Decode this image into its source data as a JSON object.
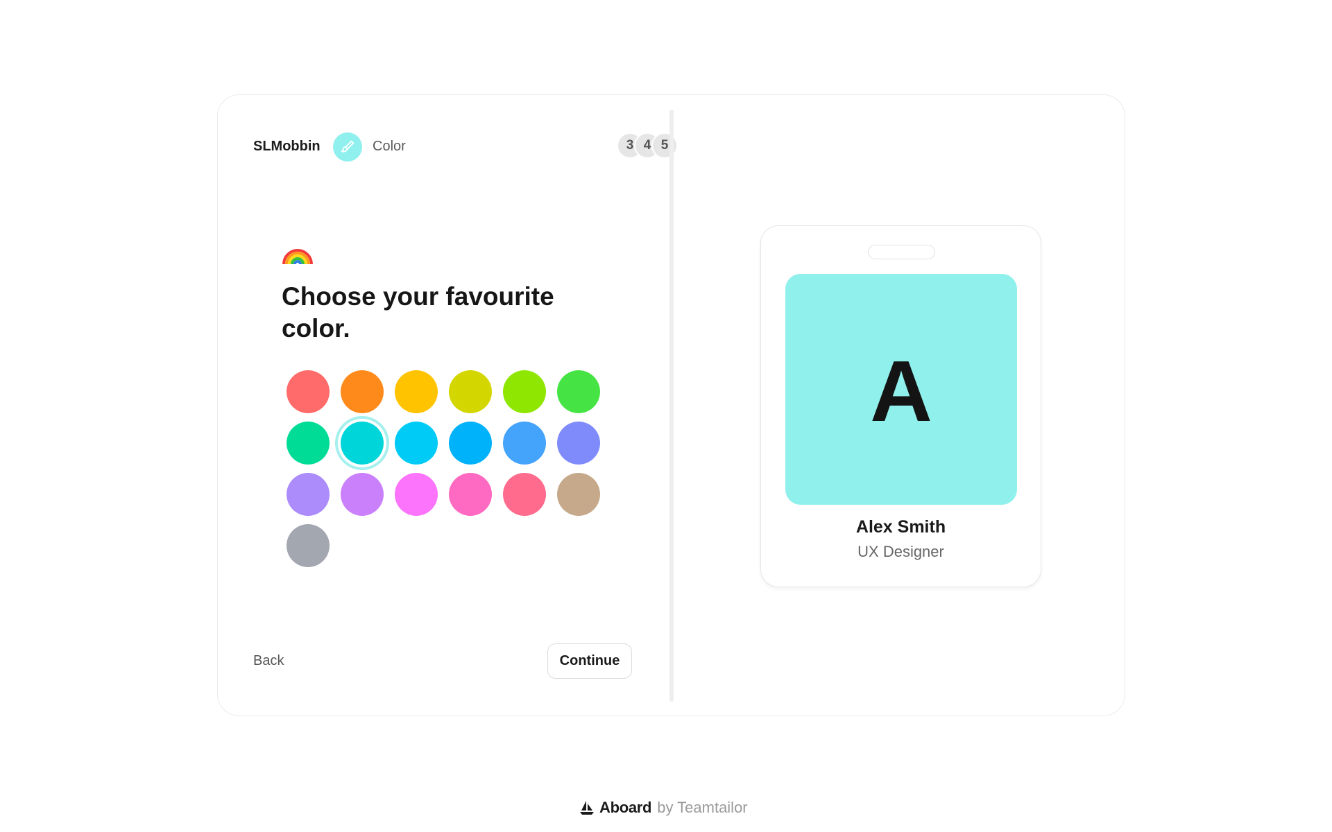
{
  "app": {
    "org_name": "SLMobbin",
    "step_title": "Color",
    "step_icon": "paintbrush-icon",
    "steps": [
      "3",
      "4",
      "5"
    ]
  },
  "question": {
    "emoji_icon": "rainbow-icon",
    "headline": "Choose your favourite color."
  },
  "colors": {
    "selected_index": 7,
    "swatches": [
      {
        "name": "red",
        "hex": "#ff6b6b"
      },
      {
        "name": "orange",
        "hex": "#ff8a1c"
      },
      {
        "name": "amber",
        "hex": "#ffc300"
      },
      {
        "name": "olive",
        "hex": "#d4d600"
      },
      {
        "name": "lime",
        "hex": "#8fe600"
      },
      {
        "name": "green",
        "hex": "#45e444"
      },
      {
        "name": "emerald",
        "hex": "#00db95"
      },
      {
        "name": "teal",
        "hex": "#00d6d9"
      },
      {
        "name": "cyan",
        "hex": "#00cbf6"
      },
      {
        "name": "sky",
        "hex": "#00b2fa"
      },
      {
        "name": "blue",
        "hex": "#44a3fb"
      },
      {
        "name": "periwinkle",
        "hex": "#7f8bfb"
      },
      {
        "name": "lavender",
        "hex": "#ac8bfb"
      },
      {
        "name": "violet",
        "hex": "#cb80fb"
      },
      {
        "name": "magenta",
        "hex": "#fc74fb"
      },
      {
        "name": "pink",
        "hex": "#fe6ac1"
      },
      {
        "name": "rose",
        "hex": "#fe6b8d"
      },
      {
        "name": "tan",
        "hex": "#c6a98a"
      },
      {
        "name": "gray",
        "hex": "#a2a7b0"
      }
    ]
  },
  "nav": {
    "back_label": "Back",
    "continue_label": "Continue"
  },
  "badge": {
    "initial": "A",
    "name": "Alex Smith",
    "role": "UX Designer",
    "color": "#90f0ec"
  },
  "footer": {
    "logo_icon": "sailboat-icon",
    "brand": "Aboard",
    "by": "by Teamtailor"
  }
}
